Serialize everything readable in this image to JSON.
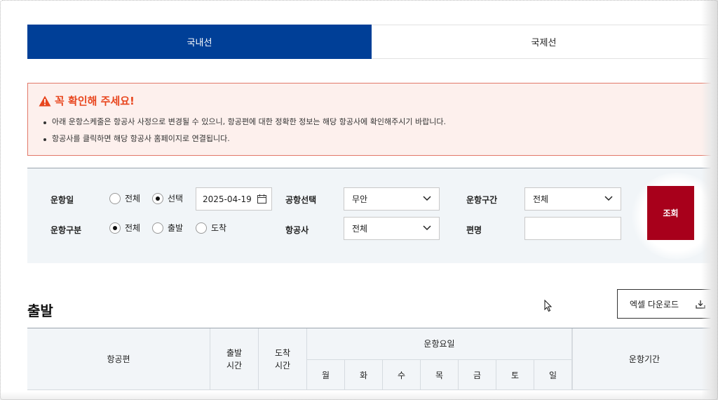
{
  "tabs": [
    {
      "label": "국내선",
      "active": true
    },
    {
      "label": "국제선",
      "active": false
    }
  ],
  "notice": {
    "title": "꼭 확인해 주세요!",
    "items": [
      "아래 운항스케줄은 항공사 사정으로 변경될 수 있으니, 항공편에 대한 정확한 정보는 해당 항공사에 확인해주시기 바랍니다.",
      "항공사를 클릭하면 해당 항공사 홈페이지로 연결됩니다."
    ]
  },
  "search": {
    "flight_date_label": "운항일",
    "date_options": [
      {
        "label": "전체",
        "selected": false
      },
      {
        "label": "선택",
        "selected": true
      }
    ],
    "date_value": "2025-04-19",
    "flight_type_label": "운항구분",
    "type_options": [
      {
        "label": "전체",
        "selected": true
      },
      {
        "label": "출발",
        "selected": false
      },
      {
        "label": "도착",
        "selected": false
      }
    ],
    "airport_label": "공항선택",
    "airport_value": "무안",
    "airline_label": "항공사",
    "airline_value": "전체",
    "route_label": "운항구간",
    "route_value": "전체",
    "flight_no_label": "편명",
    "flight_no_value": "",
    "submit_label": "조회"
  },
  "departure": {
    "title": "출발",
    "excel_label": "엑셀 다운로드",
    "table_headers": {
      "flight": "항공편",
      "dep_time": "출발\n시간",
      "arr_time": "도착\n시간",
      "days_group": "운항요일",
      "days": [
        "월",
        "화",
        "수",
        "목",
        "금",
        "토",
        "일"
      ],
      "period": "운항기간"
    }
  },
  "colors": {
    "tab_active": "#003f97",
    "notice_title": "#e8461e",
    "submit_button": "#a8001b"
  }
}
